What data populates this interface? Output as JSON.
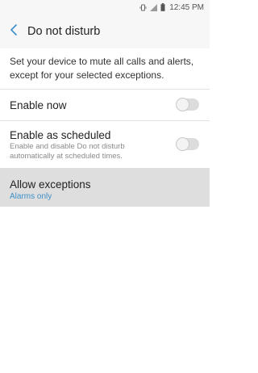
{
  "status_bar": {
    "time": "12:45 PM",
    "icons": [
      "vibrate-icon",
      "signal-icon",
      "battery-icon"
    ]
  },
  "app_bar": {
    "title": "Do not disturb",
    "back_icon": "chevron-left-icon"
  },
  "intro": {
    "text": "Set your device to mute all calls and alerts, except for your selected exceptions."
  },
  "settings": {
    "enable_now": {
      "label": "Enable now",
      "enabled": false
    },
    "enable_scheduled": {
      "label": "Enable as scheduled",
      "description": "Enable and disable Do not disturb automatically at scheduled times.",
      "enabled": false
    },
    "allow_exceptions": {
      "label": "Allow exceptions",
      "value": "Alarms only"
    }
  },
  "colors": {
    "accent": "#3c8fc9",
    "toggle_off_track": "#dcdcdc",
    "highlight_row": "#dedede"
  }
}
